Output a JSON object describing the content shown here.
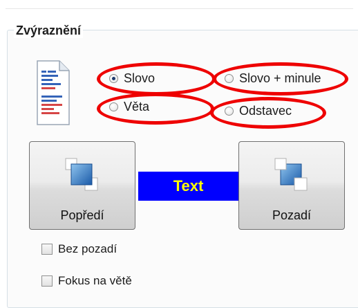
{
  "group": {
    "title": "Zvýraznění"
  },
  "icons": {
    "document": "document-icon",
    "foreground": "foreground-color-icon",
    "background": "background-color-icon"
  },
  "highlight_options": [
    {
      "label": "Slovo",
      "checked": true
    },
    {
      "label": "Slovo + minule",
      "checked": false
    },
    {
      "label": "Věta",
      "checked": false
    },
    {
      "label": "Odstavec",
      "checked": false
    }
  ],
  "buttons": {
    "foreground_label": "Popředí",
    "background_label": "Pozadí"
  },
  "sample": {
    "text": "Text",
    "text_color": "#ffff00",
    "background_color": "#0000ff"
  },
  "checkboxes": [
    {
      "label": "Bez pozadí",
      "checked": false
    },
    {
      "label": "Fokus na větě",
      "checked": false
    }
  ],
  "annotation_color": "#ee0000"
}
